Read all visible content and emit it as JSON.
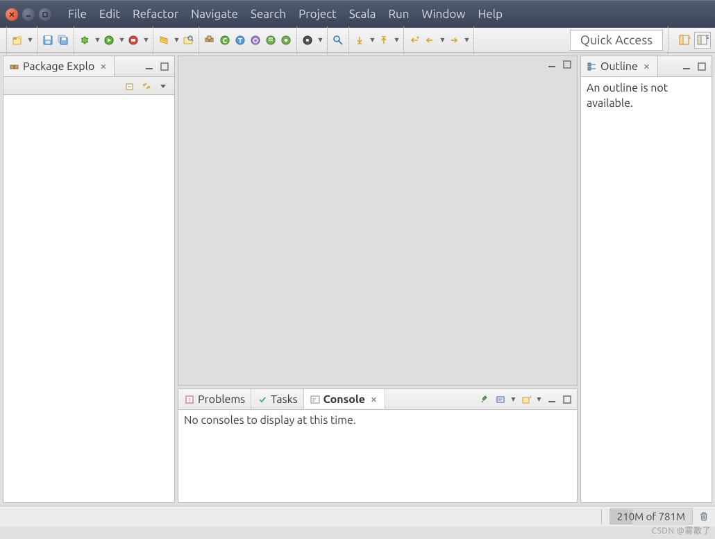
{
  "menubar": {
    "items": [
      "File",
      "Edit",
      "Refactor",
      "Navigate",
      "Search",
      "Project",
      "Scala",
      "Run",
      "Window",
      "Help"
    ]
  },
  "quick_access": {
    "placeholder": "Quick Access"
  },
  "views": {
    "package_explorer": {
      "title": "Package Explo"
    },
    "outline": {
      "title": "Outline",
      "message": "An outline is not available."
    },
    "problems": {
      "title": "Problems"
    },
    "tasks": {
      "title": "Tasks"
    },
    "console": {
      "title": "Console",
      "message": "No consoles to display at this time."
    }
  },
  "status": {
    "heap": "210M of 781M"
  },
  "watermark": "CSDN @雾散了"
}
